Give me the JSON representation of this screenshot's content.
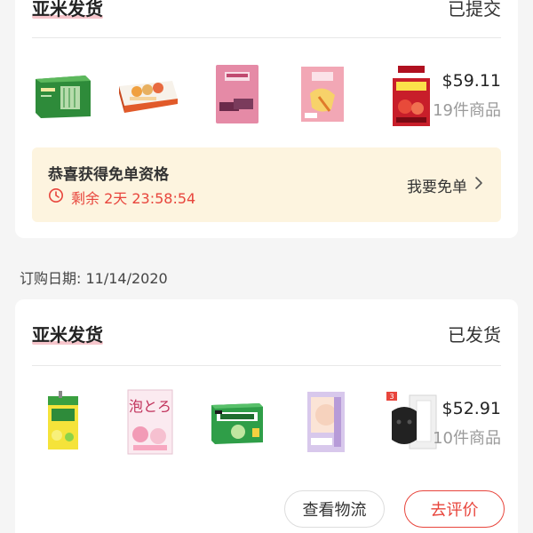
{
  "orders": [
    {
      "seller": "亚米发货",
      "status": "已提交",
      "products": [
        {
          "icon": "green-tea-box-icon"
        },
        {
          "icon": "pastry-box-icon"
        },
        {
          "icon": "pink-snack-bag-icon"
        },
        {
          "icon": "dried-fruit-bag-icon"
        },
        {
          "icon": "apple-vinegar-box-icon"
        }
      ],
      "price": "$59.11",
      "count": "19件商品",
      "free_order": {
        "title": "恭喜获得免单资格",
        "countdown": "剩余 2天 23:58:54",
        "button": "我要免单"
      }
    },
    {
      "seller": "亚米发货",
      "status": "已发货",
      "products": [
        {
          "icon": "lemon-tea-drink-icon"
        },
        {
          "icon": "bath-foam-box-icon"
        },
        {
          "icon": "cold-granules-box-icon"
        },
        {
          "icon": "face-mask-pack-icon"
        },
        {
          "icon": "black-mask-box-icon"
        }
      ],
      "price": "$52.91",
      "count": "10件商品",
      "buttons": {
        "logistics": "查看物流",
        "review": "去评价"
      }
    }
  ],
  "order_date": "订购日期: 11/14/2020",
  "colors": {
    "accent": "#e8453c",
    "banner_bg": "#fdf4df",
    "page_bg": "#f5f5f5"
  }
}
